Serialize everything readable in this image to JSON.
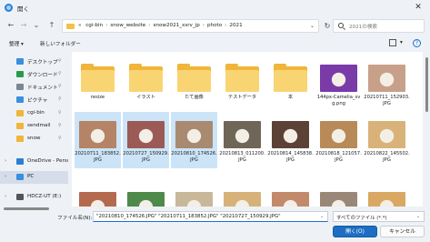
{
  "window": {
    "title": "開く",
    "close_symbol": "✕"
  },
  "nav": {
    "back": "←",
    "forward": "→",
    "dropdown": "⌄",
    "up": "↑",
    "refresh": "↻",
    "breadcrumb_prefix": "«",
    "breadcrumb": [
      "cgi-bin",
      "snow_website",
      "snow2021_xsrv_jp",
      "photo",
      "2021"
    ],
    "breadcrumb_sep": "›",
    "address_dropdown": "⌄",
    "search_placeholder": "2021の検索"
  },
  "toolbar": {
    "organize": "整理 ▾",
    "new_folder": "新しいフォルダー",
    "view": "▾"
  },
  "sidebar": {
    "items": [
      {
        "label": "デスクトップ",
        "icon": "desktop-icon",
        "color": "#3b8fdc",
        "pinned": true
      },
      {
        "label": "ダウンロード",
        "icon": "download-icon",
        "color": "#2a9a4a",
        "pinned": true
      },
      {
        "label": "ドキュメント",
        "icon": "document-icon",
        "color": "#7a8694",
        "pinned": true
      },
      {
        "label": "ピクチャ",
        "icon": "pictures-icon",
        "color": "#3b8fdc",
        "pinned": true
      },
      {
        "label": "cgi-bin",
        "icon": "folder-icon",
        "color": "#f0b53a",
        "pinned": true
      },
      {
        "label": "sendmail",
        "icon": "folder-icon",
        "color": "#f0b53a",
        "pinned": true
      },
      {
        "label": "snow",
        "icon": "folder-icon",
        "color": "#f0b53a",
        "pinned": true
      },
      {
        "label": "OneDrive - Perso",
        "icon": "cloud-icon",
        "color": "#2a7fd4",
        "pinned": false,
        "chevron": "›"
      },
      {
        "label": "PC",
        "icon": "pc-icon",
        "color": "#3b8fdc",
        "pinned": false,
        "chevron": "›",
        "selected": true
      },
      {
        "label": "HDCZ-UT (E:)",
        "icon": "drive-icon",
        "color": "#555",
        "pinned": false,
        "chevron": "›"
      }
    ],
    "pin_symbol": "📌"
  },
  "files": [
    {
      "name": "resize",
      "kind": "folder"
    },
    {
      "name": "イラスト",
      "kind": "folder"
    },
    {
      "name": "たて画像",
      "kind": "folder"
    },
    {
      "name": "テストデータ",
      "kind": "folder"
    },
    {
      "name": "本",
      "kind": "folder"
    },
    {
      "name": "144px-Camelia_svg.png",
      "kind": "image",
      "color": "#7a3aa8"
    },
    {
      "name": "20210711_152903.JPG",
      "kind": "image",
      "color": "#c8a08a"
    },
    {
      "name": "20210711_183852.JPG",
      "kind": "image",
      "color": "#b58366",
      "selected": true
    },
    {
      "name": "20210727_150929.JPG",
      "kind": "image",
      "color": "#9b5a56",
      "selected": true
    },
    {
      "name": "20210810_174526.JPG",
      "kind": "image",
      "color": "#a88a70",
      "selected": true
    },
    {
      "name": "20210813_011200.JPG",
      "kind": "image",
      "color": "#6f6658"
    },
    {
      "name": "20210814_145838.JPG",
      "kind": "image",
      "color": "#5c4236"
    },
    {
      "name": "20210818_121057.JPG",
      "kind": "image",
      "color": "#b88a58"
    },
    {
      "name": "20210822_145502.JPG",
      "kind": "image",
      "color": "#d9b27a"
    },
    {
      "name": "",
      "kind": "image",
      "color": "#b46a4e"
    },
    {
      "name": "",
      "kind": "image",
      "color": "#4e8a4a"
    },
    {
      "name": "",
      "kind": "image",
      "color": "#c9b79a"
    },
    {
      "name": "",
      "kind": "image",
      "color": "#d6b27a"
    },
    {
      "name": "",
      "kind": "image",
      "color": "#c28a6a"
    },
    {
      "name": "",
      "kind": "image",
      "color": "#9a8778"
    },
    {
      "name": "",
      "kind": "image",
      "color": "#d9a862"
    }
  ],
  "bottom": {
    "filename_label": "ファイル名(N):",
    "filename_value": "\"20210810_174526.JPG\" \"20210711_183852.JPG\" \"20210727_150929.JPG\"",
    "filter_value": "すべてのファイル (*.*)",
    "dropdown": "⌄",
    "open_label": "開く(O)",
    "cancel_label": "キャンセル"
  },
  "colors": {
    "accent": "#1d6dc3",
    "selection": "#cce4f7",
    "folder": "#f0b53a"
  }
}
